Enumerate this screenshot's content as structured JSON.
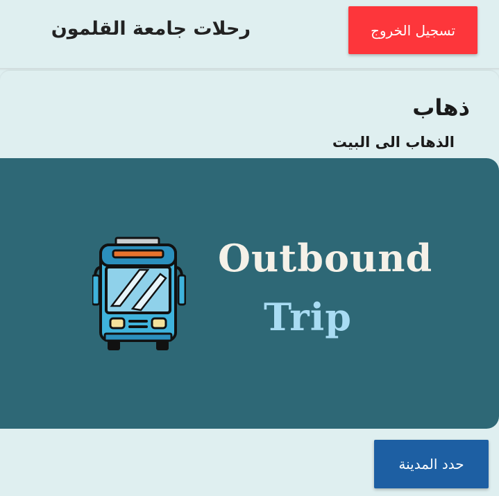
{
  "header": {
    "title": "رحلات جامعة القلمون",
    "logout_label": "تسجيل الخروج"
  },
  "trip_card": {
    "title": "ذهاب",
    "subtitle": "الذهاب الى البيت",
    "banner": {
      "line1": "Outbound",
      "line2": "Trip",
      "icon": "bus-icon"
    },
    "select_city_label": "حدد المدينة"
  },
  "colors": {
    "background": "#dfeff0",
    "logout_button": "#fd363b",
    "select_city_button": "#1d5fa3",
    "banner_background": "#2e6876",
    "banner_line1": "#f5f1e8",
    "banner_line2": "#a9dcf3",
    "bus_body": "#3fb3dc"
  }
}
